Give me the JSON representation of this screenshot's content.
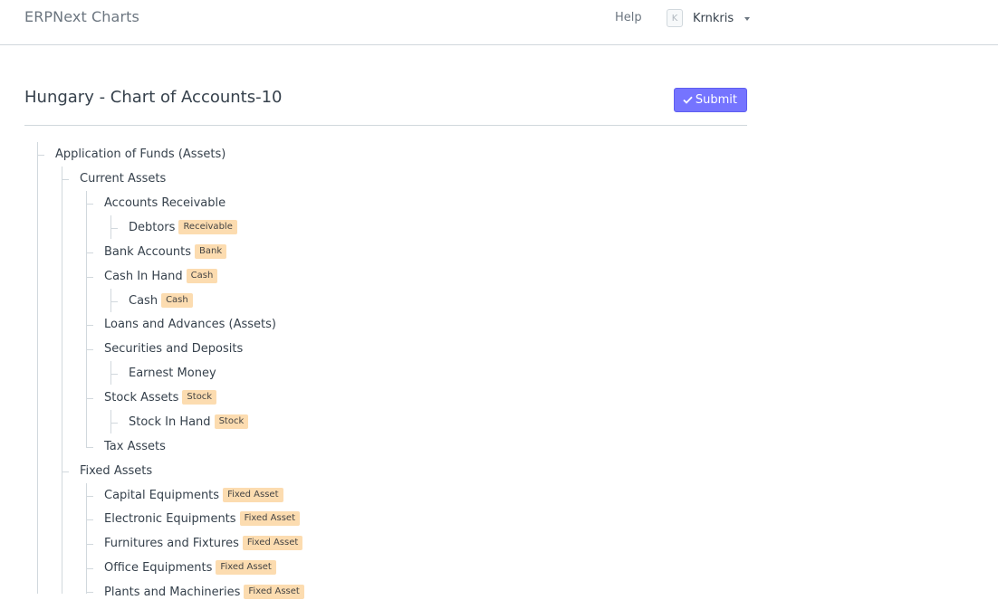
{
  "navbar": {
    "brand": "ERPNext Charts",
    "help_label": "Help",
    "avatar_initial": "K",
    "username": "Krnkris"
  },
  "page": {
    "title": "Hungary - Chart of Accounts-10",
    "submit_label": "Submit"
  },
  "tree": {
    "n0": {
      "label": "Application of Funds (Assets)"
    },
    "n1": {
      "label": "Current Assets"
    },
    "n2": {
      "label": "Accounts Receivable"
    },
    "n3": {
      "label": "Debtors",
      "badge": "Receivable"
    },
    "n4": {
      "label": "Bank Accounts",
      "badge": "Bank"
    },
    "n5": {
      "label": "Cash In Hand",
      "badge": "Cash"
    },
    "n6": {
      "label": "Cash",
      "badge": "Cash"
    },
    "n7": {
      "label": "Loans and Advances (Assets)"
    },
    "n8": {
      "label": "Securities and Deposits"
    },
    "n9": {
      "label": "Earnest Money"
    },
    "n10": {
      "label": "Stock Assets",
      "badge": "Stock"
    },
    "n11": {
      "label": "Stock In Hand",
      "badge": "Stock"
    },
    "n12": {
      "label": "Tax Assets"
    },
    "n13": {
      "label": "Fixed Assets"
    },
    "n14": {
      "label": "Capital Equipments",
      "badge": "Fixed Asset"
    },
    "n15": {
      "label": "Electronic Equipments",
      "badge": "Fixed Asset"
    },
    "n16": {
      "label": "Furnitures and Fixtures",
      "badge": "Fixed Asset"
    },
    "n17": {
      "label": "Office Equipments",
      "badge": "Fixed Asset"
    },
    "n18": {
      "label": "Plants and Machineries",
      "badge": "Fixed Asset"
    }
  },
  "colors": {
    "accent": "#7574ff",
    "badge_bg": "#fcdcb0",
    "border": "#d1d8dd"
  }
}
